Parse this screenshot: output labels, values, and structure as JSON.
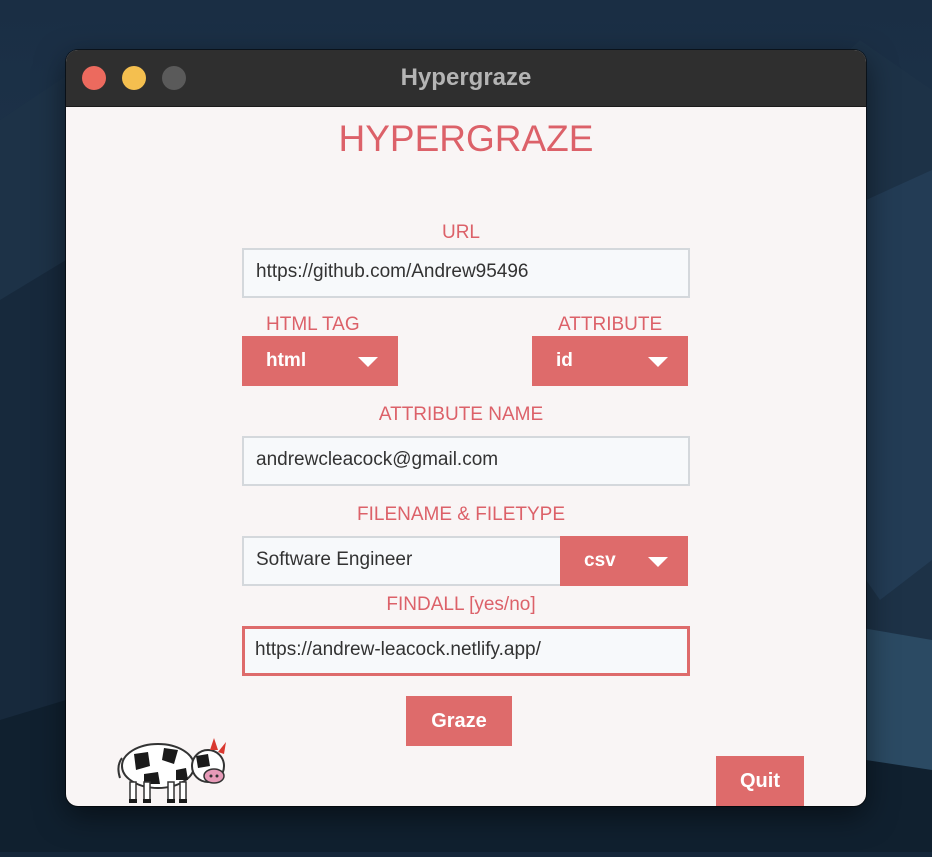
{
  "window": {
    "title": "Hypergraze"
  },
  "app": {
    "heading": "HYPERGRAZE",
    "url": {
      "label": "URL",
      "value": "https://github.com/Andrew95496"
    },
    "html_tag": {
      "label": "HTML TAG",
      "selected": "html"
    },
    "attribute": {
      "label": "ATTRIBUTE",
      "selected": "id"
    },
    "attribute_name": {
      "label": "ATTRIBUTE NAME",
      "value": "andrewcleacock@gmail.com"
    },
    "filename": {
      "label": "FILENAME & FILETYPE",
      "value": "Software Engineer",
      "filetype": "csv"
    },
    "findall": {
      "label": "FINDALL [yes/no]",
      "value": "https://andrew-leacock.netlify.app/"
    },
    "graze_label": "Graze",
    "quit_label": "Quit"
  },
  "colors": {
    "accent": "#de6b6b",
    "label_text": "#dc6169",
    "background": "#f9f5f5",
    "titlebar": "#2f2f2f"
  },
  "icons": {
    "mascot": "cow-icon",
    "dropdown": "chevron-down-icon"
  }
}
